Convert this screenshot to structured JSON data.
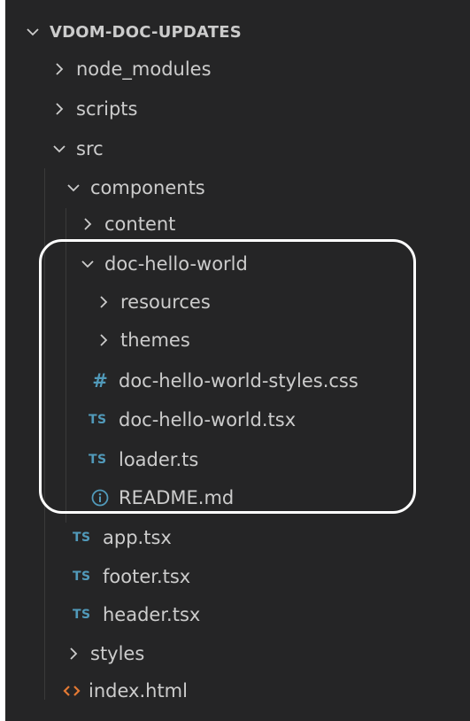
{
  "explorer": {
    "root": {
      "label": "VDOM-DOC-UPDATES",
      "expanded": true
    },
    "items": [
      {
        "label": "node_modules",
        "type": "folder",
        "expanded": false
      },
      {
        "label": "scripts",
        "type": "folder",
        "expanded": false
      },
      {
        "label": "src",
        "type": "folder",
        "expanded": true
      },
      {
        "label": "components",
        "type": "folder",
        "expanded": true
      },
      {
        "label": "content",
        "type": "folder",
        "expanded": false
      },
      {
        "label": "doc-hello-world",
        "type": "folder",
        "expanded": true
      },
      {
        "label": "resources",
        "type": "folder",
        "expanded": false
      },
      {
        "label": "themes",
        "type": "folder",
        "expanded": false
      },
      {
        "label": "doc-hello-world-styles.css",
        "type": "css",
        "icon_text": "#"
      },
      {
        "label": "doc-hello-world.tsx",
        "type": "ts",
        "icon_text": "TS"
      },
      {
        "label": "loader.ts",
        "type": "ts",
        "icon_text": "TS"
      },
      {
        "label": "README.md",
        "type": "info"
      },
      {
        "label": "app.tsx",
        "type": "ts",
        "icon_text": "TS"
      },
      {
        "label": "footer.tsx",
        "type": "ts",
        "icon_text": "TS"
      },
      {
        "label": "header.tsx",
        "type": "ts",
        "icon_text": "TS"
      },
      {
        "label": "styles",
        "type": "folder",
        "expanded": false
      },
      {
        "label": "index.html",
        "type": "html"
      }
    ]
  },
  "colors": {
    "panel_bg": "#252526",
    "text": "#cccccc",
    "ts_icon": "#519aba",
    "html_icon": "#e37933",
    "highlight_outline": "#ffffff"
  }
}
